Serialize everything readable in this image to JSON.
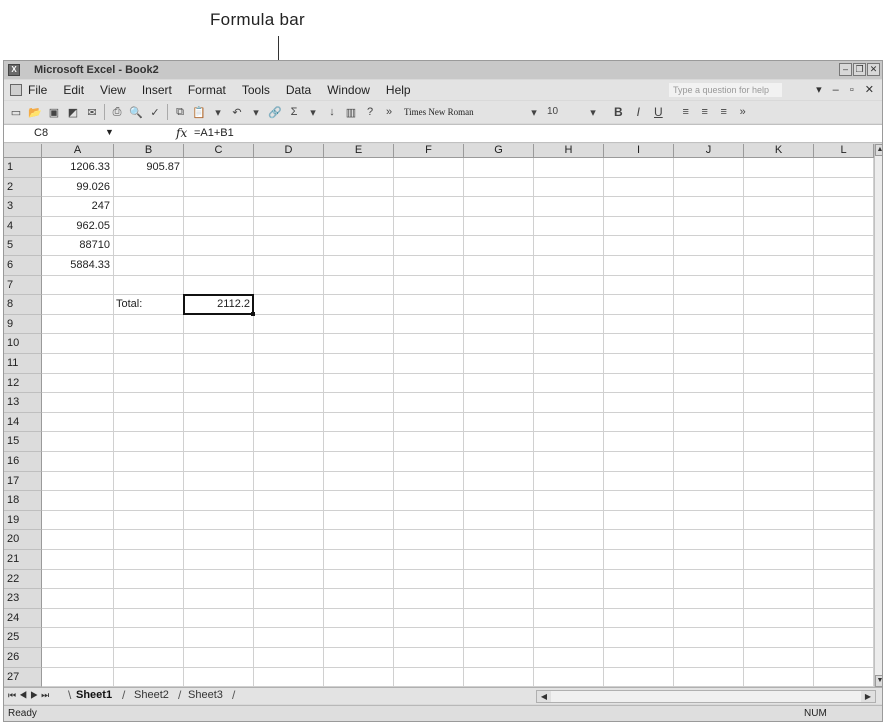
{
  "annotation": {
    "label": "Formula bar"
  },
  "window": {
    "title": "Microsoft Excel - Book2",
    "buttons": [
      "minimize",
      "restore",
      "close"
    ]
  },
  "menubar": {
    "items": [
      "File",
      "Edit",
      "View",
      "Insert",
      "Format",
      "Tools",
      "Data",
      "Window",
      "Help"
    ],
    "help_placeholder": "Type a question for help"
  },
  "toolbar": {
    "font_name": "Times New Roman",
    "font_size": "10",
    "bold": "B",
    "italic": "I",
    "underline": "U"
  },
  "formula_bar": {
    "name_box": "C8",
    "fx_symbol": "fx",
    "formula": "=A1+B1"
  },
  "sheet": {
    "columns": [
      "A",
      "B",
      "C",
      "D",
      "E",
      "F",
      "G",
      "H",
      "I",
      "J",
      "K",
      "L"
    ],
    "rows": [
      "1",
      "2",
      "3",
      "4",
      "5",
      "6",
      "7",
      "8",
      "9",
      "10",
      "11",
      "12",
      "13",
      "14",
      "15",
      "16",
      "17",
      "18",
      "19",
      "20",
      "21",
      "22",
      "23",
      "24",
      "25",
      "26",
      "27"
    ],
    "cells": {
      "A1": "1206.33",
      "B1": "905.87",
      "A2": "99.026",
      "A3": "247",
      "A4": "962.05",
      "A5": "88710",
      "A6": "5884.33",
      "B8": "Total:",
      "C8": "2112.2"
    },
    "active_cell": "C8"
  },
  "tabs": {
    "items": [
      "Sheet1",
      "Sheet2",
      "Sheet3"
    ],
    "active": "Sheet1"
  },
  "status": {
    "left": "Ready",
    "num": "NUM"
  }
}
